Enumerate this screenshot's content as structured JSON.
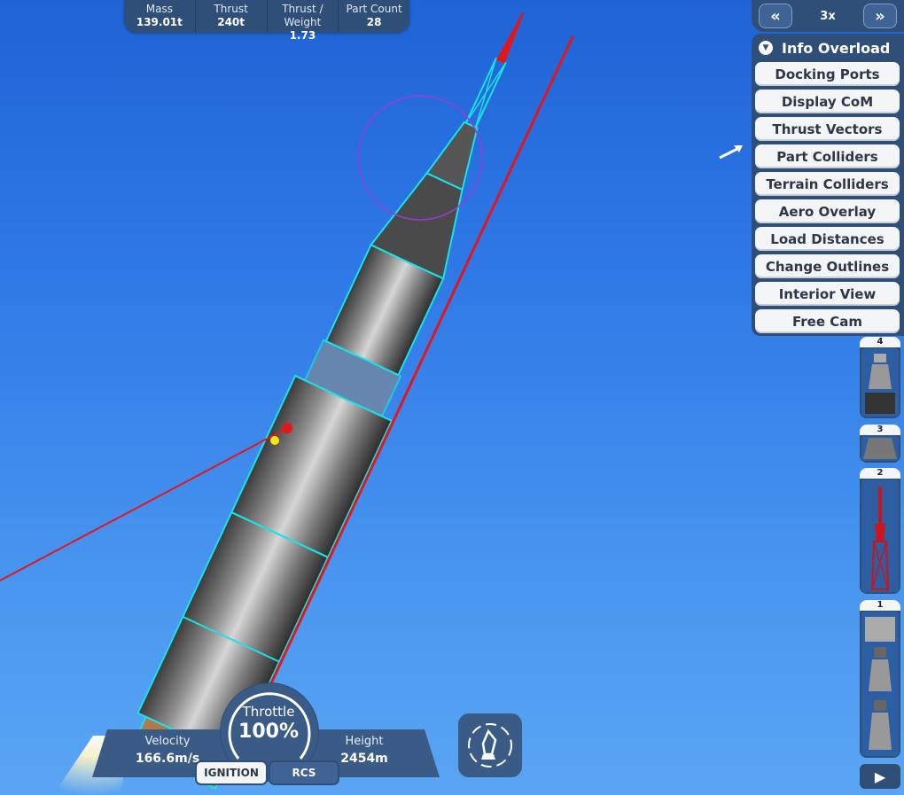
{
  "stats": [
    {
      "label": "Mass",
      "value": "139.01t"
    },
    {
      "label": "Thrust",
      "value": "240t"
    },
    {
      "label": "Thrust / Weight",
      "value": "1.73"
    },
    {
      "label": "Part Count",
      "value": "28"
    }
  ],
  "timewarp": {
    "back_icon": "double-chevron-left-icon",
    "value": "3x",
    "forward_icon": "double-chevron-right-icon"
  },
  "info_overload": {
    "title": "Info Overload",
    "buttons": [
      "Docking Ports",
      "Display CoM",
      "Thrust Vectors",
      "Part Colliders",
      "Terrain Colliders",
      "Aero Overlay",
      "Load Distances",
      "Change Outlines",
      "Interior View",
      "Free Cam"
    ]
  },
  "stages": [
    "4",
    "3",
    "2",
    "1"
  ],
  "flight": {
    "velocity_label": "Velocity",
    "velocity_value": "166.6m/s",
    "throttle_label": "Throttle",
    "throttle_value": "100%",
    "height_label": "Height",
    "height_value": "2454m",
    "ignition_label": "IGNITION",
    "rcs_label": "RCS"
  },
  "colors": {
    "panel": "#2f4f78",
    "sky": "#2f79e6",
    "outline_cyan": "#18e3e6",
    "outline_red": "#e3161c"
  }
}
